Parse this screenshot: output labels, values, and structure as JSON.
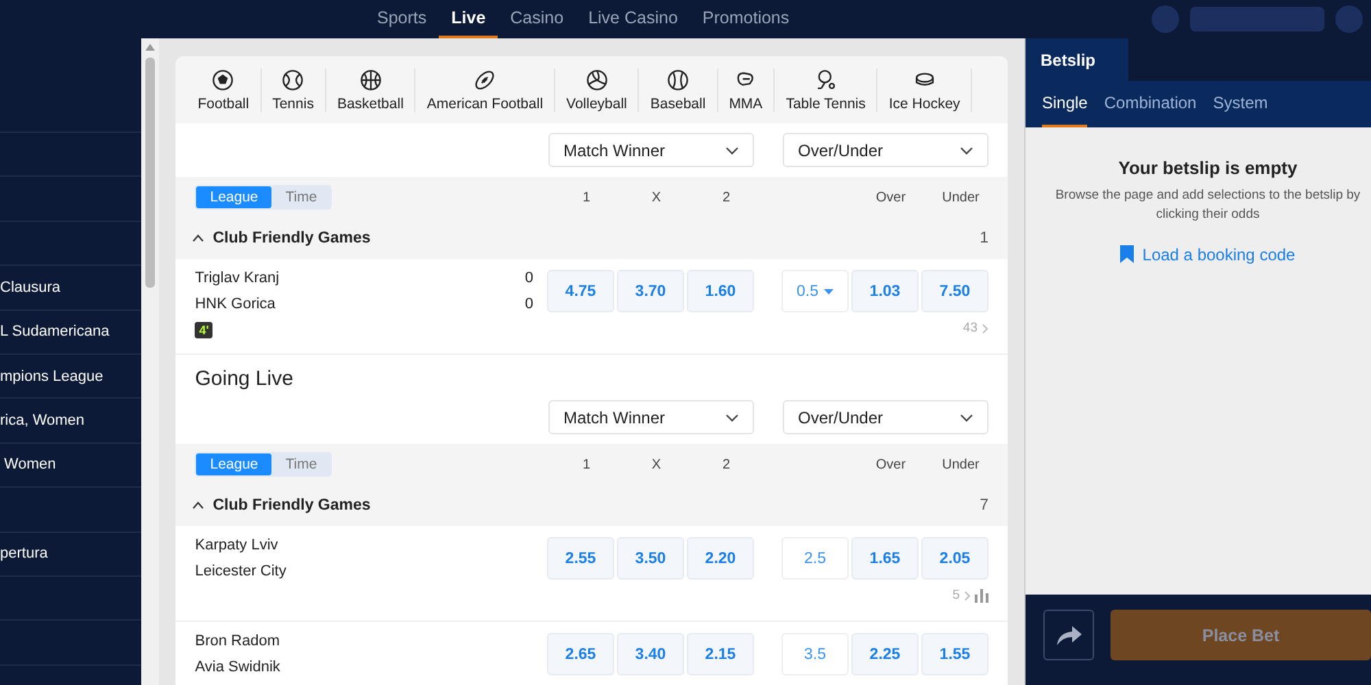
{
  "nav": {
    "items": [
      {
        "label": "Sports",
        "selected": false
      },
      {
        "label": "Live",
        "selected": true
      },
      {
        "label": "Casino",
        "selected": false
      },
      {
        "label": "Live Casino",
        "selected": false
      },
      {
        "label": "Promotions",
        "selected": false
      }
    ]
  },
  "sidebar": {
    "items": [
      {
        "kind": "blank"
      },
      {
        "kind": "blank"
      },
      {
        "kind": "blank"
      },
      {
        "kind": "blank"
      },
      {
        "kind": "link",
        "label": "Clausura"
      },
      {
        "kind": "link",
        "label": "L Sudamericana"
      },
      {
        "kind": "link",
        "label": "mpions League"
      },
      {
        "kind": "link",
        "label": "rica, Women"
      },
      {
        "kind": "link",
        "label": " Women"
      },
      {
        "kind": "blank"
      },
      {
        "kind": "link",
        "label": "pertura"
      },
      {
        "kind": "blank"
      },
      {
        "kind": "blank"
      }
    ]
  },
  "sports": [
    {
      "label": "Football",
      "kind": "football"
    },
    {
      "label": "Tennis",
      "kind": "tennis"
    },
    {
      "label": "Basketball",
      "kind": "basketball"
    },
    {
      "label": "American Football",
      "kind": "american-football"
    },
    {
      "label": "Volleyball",
      "kind": "volleyball"
    },
    {
      "label": "Baseball",
      "kind": "baseball"
    },
    {
      "label": "MMA",
      "kind": "mma"
    },
    {
      "label": "Table Tennis",
      "kind": "table-tennis"
    },
    {
      "label": "Ice Hockey",
      "kind": "ice-hockey"
    }
  ],
  "sections": [
    {
      "markets": [
        "Match Winner",
        "Over/Under"
      ],
      "toggle": [
        {
          "label": "League",
          "selected": true
        },
        {
          "label": "Time",
          "selected": false
        }
      ],
      "columns": [
        "1",
        "X",
        "2",
        "Over",
        "Under"
      ],
      "league": {
        "name": "Club Friendly Games",
        "count": "1",
        "expanded": true
      },
      "matches": [
        {
          "home": "Triglav Kranj",
          "away": "HNK Gorica",
          "home_score": "0",
          "away_score": "0",
          "time": "4'",
          "odds": [
            "4.75",
            "3.70",
            "1.60"
          ],
          "line": "0.5",
          "line_selectable": true,
          "over": "1.03",
          "under": "7.50",
          "more": "43"
        }
      ]
    },
    {
      "title": "Going Live",
      "markets": [
        "Match Winner",
        "Over/Under"
      ],
      "toggle": [
        {
          "label": "League",
          "selected": true
        },
        {
          "label": "Time",
          "selected": false
        }
      ],
      "columns": [
        "1",
        "X",
        "2",
        "Over",
        "Under"
      ],
      "league": {
        "name": "Club Friendly Games",
        "count": "7",
        "expanded": true
      },
      "matches": [
        {
          "home": "Karpaty Lviv",
          "away": "Leicester City",
          "odds": [
            "2.55",
            "3.50",
            "2.20"
          ],
          "line": "2.5",
          "line_selectable": false,
          "over": "1.65",
          "under": "2.05",
          "more": "5",
          "stats": true
        },
        {
          "home": "Bron Radom",
          "away": "Avia Swidnik",
          "odds": [
            "2.65",
            "3.40",
            "2.15"
          ],
          "line": "3.5",
          "line_selectable": false,
          "over": "2.25",
          "under": "1.55"
        }
      ]
    }
  ],
  "betslip": {
    "title": "Betslip",
    "tabs": [
      {
        "label": "Single",
        "selected": true
      },
      {
        "label": "Combination",
        "selected": false
      },
      {
        "label": "System",
        "selected": false
      }
    ],
    "empty_title": "Your betslip is empty",
    "empty_text": "Browse the page and add selections to the betslip by clicking their odds",
    "booking_link": "Load a booking code",
    "place_bet": {
      "label": "Place Bet",
      "disabled": true
    }
  }
}
